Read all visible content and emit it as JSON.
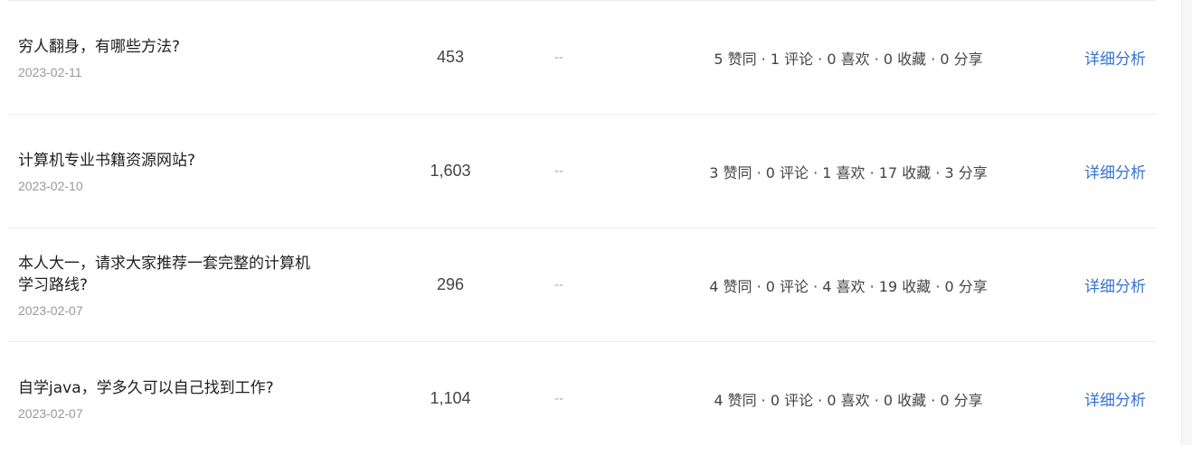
{
  "rows": [
    {
      "title": "穷人翻身，有哪些方法?",
      "date": "2023-02-11",
      "views": "453",
      "placeholder": "--",
      "stats": "5 赞同 · 1 评论 · 0 喜欢 · 0 收藏 · 0 分享",
      "action": "详细分析"
    },
    {
      "title": "计算机专业书籍资源网站?",
      "date": "2023-02-10",
      "views": "1,603",
      "placeholder": "--",
      "stats": "3 赞同 · 0 评论 · 1 喜欢 · 17 收藏 · 3 分享",
      "action": "详细分析"
    },
    {
      "title": "本人大一，请求大家推荐一套完整的计算机学习路线?",
      "date": "2023-02-07",
      "views": "296",
      "placeholder": "--",
      "stats": "4 赞同 · 0 评论 · 4 喜欢 · 19 收藏 · 0 分享",
      "action": "详细分析"
    },
    {
      "title": "自学java，学多久可以自己找到工作?",
      "date": "2023-02-07",
      "views": "1,104",
      "placeholder": "--",
      "stats": "4 赞同 · 0 评论 · 0 喜欢 · 0 收藏 · 0 分享",
      "action": "详细分析"
    }
  ],
  "colors": {
    "link": "#3773d1",
    "date": "#999999",
    "divider": "#ececec"
  }
}
